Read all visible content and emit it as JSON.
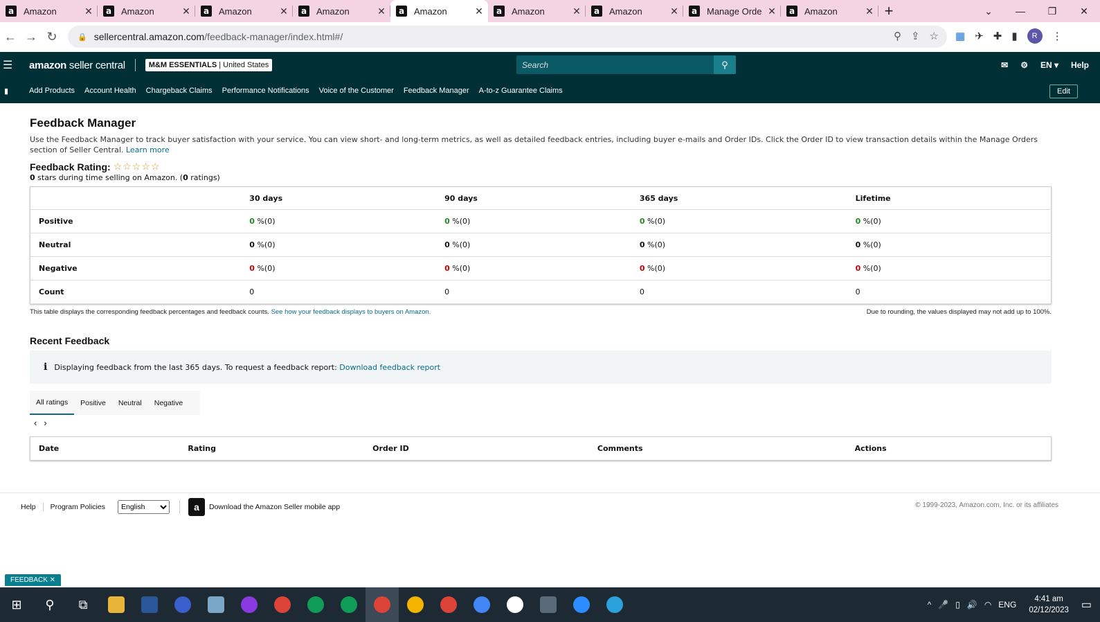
{
  "browser": {
    "tabs": [
      {
        "title": "Amazon"
      },
      {
        "title": "Amazon"
      },
      {
        "title": "Amazon"
      },
      {
        "title": "Amazon"
      },
      {
        "title": "Amazon",
        "active": true
      },
      {
        "title": "Amazon"
      },
      {
        "title": "Amazon"
      },
      {
        "title": "Manage Orde"
      },
      {
        "title": "Amazon"
      }
    ],
    "url_host": "sellercentral.amazon.com",
    "url_path": "/feedback-manager/index.html#/",
    "avatar_letter": "R"
  },
  "header": {
    "logo_bold": "amazon",
    "logo_rest": " seller central",
    "store_name": "M&M ESSENTIALS",
    "store_region": "United States",
    "search_placeholder": "Search",
    "language": "EN",
    "help": "Help"
  },
  "nav": {
    "links": [
      "Add Products",
      "Account Health",
      "Chargeback Claims",
      "Performance Notifications",
      "Voice of the Customer",
      "Feedback Manager",
      "A-to-z Guarantee Claims"
    ],
    "edit": "Edit"
  },
  "page": {
    "title": "Feedback Manager",
    "description": "Use the Feedback Manager to track buyer satisfaction with your service. You can view short- and long-term metrics, as well as detailed feedback entries, including buyer e-mails and Order IDs. Click the Order ID to view transaction details within the Manage Orders section of Seller Central.",
    "learn_more": "Learn more",
    "rating_label": "Feedback Rating:",
    "stars": "☆☆☆☆☆",
    "rating_sub_count": "0",
    "rating_sub_text": " stars during time selling on Amazon. (",
    "rating_sub_num": "0",
    "rating_sub_end": " ratings)"
  },
  "feedback_table": {
    "headers": [
      "",
      "30 days",
      "90 days",
      "365 days",
      "Lifetime"
    ],
    "rows": [
      {
        "label": "Positive",
        "cells": [
          [
            "0",
            " %(0)"
          ],
          [
            "0",
            " %(0)"
          ],
          [
            "0",
            " %(0)"
          ],
          [
            "0",
            " %(0)"
          ]
        ]
      },
      {
        "label": "Neutral",
        "cells": [
          [
            "0",
            " %(0)"
          ],
          [
            "0",
            " %(0)"
          ],
          [
            "0",
            " %(0)"
          ],
          [
            "0",
            " %(0)"
          ]
        ]
      },
      {
        "label": "Negative",
        "cells": [
          [
            "0",
            " %(0)"
          ],
          [
            "0",
            " %(0)"
          ],
          [
            "0",
            " %(0)"
          ],
          [
            "0",
            " %(0)"
          ]
        ]
      },
      {
        "label": "Count",
        "cells": [
          [
            "",
            "0"
          ],
          [
            "",
            "0"
          ],
          [
            "",
            "0"
          ],
          [
            "",
            "0"
          ]
        ]
      }
    ],
    "note_left": "This table displays the corresponding feedback percentages and feedback counts.",
    "note_link": "See how your feedback displays to buyers on Amazon.",
    "note_right": "Due to rounding, the values displayed may not add up to 100%."
  },
  "recent": {
    "title": "Recent Feedback",
    "info_text": "Displaying feedback from the last 365 days. To request a feedback report:",
    "info_link": "Download feedback report",
    "tabs": [
      "All ratings",
      "Positive",
      "Neutral",
      "Negative"
    ],
    "columns": [
      "Date",
      "Rating",
      "Order ID",
      "Comments",
      "Actions"
    ]
  },
  "footer": {
    "help": "Help",
    "policies": "Program Policies",
    "language": "English",
    "app": "Download the Amazon Seller mobile app",
    "copyright": "© 1999-2023, Amazon.com, Inc. or its affiliates",
    "feedback_badge": "FEEDBACK ✕"
  },
  "taskbar": {
    "lang": "ENG",
    "time": "4:41 am",
    "date": "02/12/2023"
  }
}
